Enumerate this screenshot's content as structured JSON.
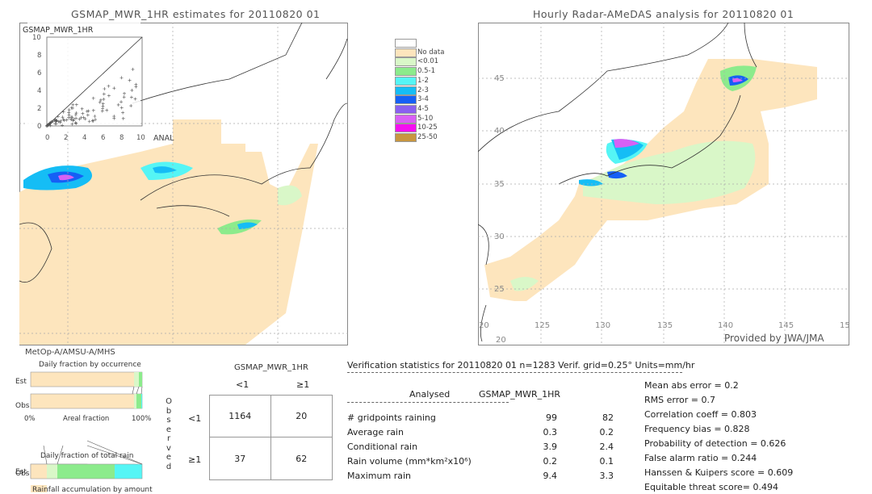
{
  "left_map": {
    "title": "GSMAP_MWR_1HR estimates for 20110820 01",
    "inset": {
      "ylabel": "GSMAP_MWR_1HR",
      "xlabel": "ANAL",
      "ticks": [
        "0",
        "2",
        "4",
        "6",
        "8",
        "10"
      ]
    },
    "satellite": "MetOp-A/AMSU-A/MHS"
  },
  "right_map": {
    "title": "Hourly Radar-AMeDAS analysis for 20110820 01",
    "lat_ticks": [
      "45",
      "40",
      "35",
      "30",
      "25",
      "20"
    ],
    "lon_ticks": [
      "125",
      "130",
      "135",
      "140",
      "145",
      "15"
    ],
    "bottom_lat": "20",
    "credit": "Provided by JWA/JMA"
  },
  "legend": {
    "items": [
      {
        "label": "",
        "color": "#ffffff"
      },
      {
        "label": "No data",
        "color": "#fde5bd"
      },
      {
        "label": "<0.01",
        "color": "#d9f7c8"
      },
      {
        "label": "0.5-1",
        "color": "#8ceb8c"
      },
      {
        "label": "1-2",
        "color": "#55f5f5"
      },
      {
        "label": "2-3",
        "color": "#15bdf5"
      },
      {
        "label": "3-4",
        "color": "#1560f5"
      },
      {
        "label": "4-5",
        "color": "#8a60f0"
      },
      {
        "label": "5-10",
        "color": "#d860f5"
      },
      {
        "label": "10-25",
        "color": "#f50ff0"
      },
      {
        "label": "25-50",
        "color": "#c89640"
      }
    ]
  },
  "fraction_charts": {
    "occurrence_title": "Daily fraction by occurrence",
    "est_label": "Est",
    "obs_label": "Obs",
    "axis_left": "0%",
    "axis_mid": "Areal fraction",
    "axis_right": "100%",
    "total_title": "Daily fraction of total rain",
    "accum_title": "Rainfall accumulation by amount"
  },
  "contingency": {
    "title": "GSMAP_MWR_1HR",
    "col_headers": [
      "<1",
      "≥1"
    ],
    "row_headers": [
      "<1",
      "≥1"
    ],
    "observed_label": [
      "O",
      "b",
      "s",
      "e",
      "r",
      "v",
      "e",
      "d"
    ],
    "cells": [
      [
        "1164",
        "20"
      ],
      [
        "37",
        "62"
      ]
    ]
  },
  "stats": {
    "header": "Verification statistics for 20110820 01   n=1283   Verif. grid=0.25°   Units=mm/hr",
    "col_analysed": "Analysed",
    "col_est": "GSMAP_MWR_1HR",
    "rows": [
      {
        "label": "# gridpoints raining",
        "analysed": "99",
        "est": "82"
      },
      {
        "label": "Average rain",
        "analysed": "0.3",
        "est": "0.2"
      },
      {
        "label": "Conditional rain",
        "analysed": "3.9",
        "est": "2.4"
      },
      {
        "label": "Rain volume (mm*km²x10⁶)",
        "analysed": "0.2",
        "est": "0.1"
      },
      {
        "label": "Maximum rain",
        "analysed": "9.4",
        "est": "3.3"
      }
    ],
    "scores": [
      "Mean abs error = 0.2",
      "RMS error = 0.7",
      "Correlation coeff = 0.803",
      "Frequency bias = 0.828",
      "Probability of detection = 0.626",
      "False alarm ratio = 0.244",
      "Hanssen & Kuipers score = 0.609",
      "Equitable threat score= 0.494"
    ]
  },
  "chart_data": {
    "type": "table",
    "contingency_table": {
      "rows": [
        "obs <1",
        "obs ≥1"
      ],
      "cols": [
        "est <1",
        "est ≥1"
      ],
      "values": [
        [
          1164,
          20
        ],
        [
          37,
          62
        ]
      ]
    },
    "scatter_range": [
      0,
      10
    ]
  }
}
